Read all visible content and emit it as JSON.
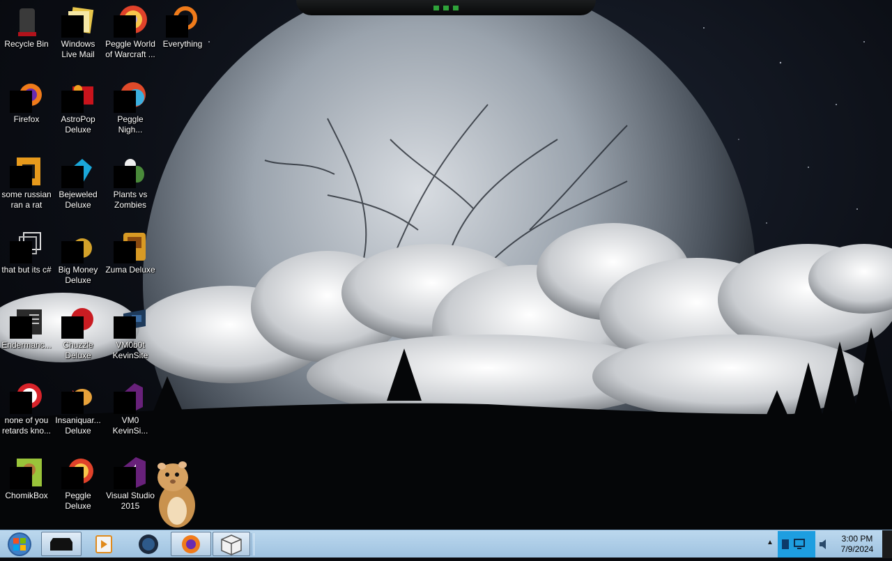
{
  "desktop": {
    "icons": [
      {
        "label": "Recycle Bin",
        "icon": "recycle-bin-icon"
      },
      {
        "label": "Windows Live Mail",
        "icon": "mail-icon"
      },
      {
        "label": "Peggle World of Warcraft ...",
        "icon": "peggle-icon"
      },
      {
        "label": "Everything",
        "icon": "search-app-icon"
      },
      {
        "label": "Firefox",
        "icon": "firefox-icon"
      },
      {
        "label": "AstroPop Deluxe",
        "icon": "game-icon"
      },
      {
        "label": "Peggle Nigh...",
        "icon": "peggle-icon"
      },
      {
        "label": "some russian ran a rat",
        "icon": "file-icon"
      },
      {
        "label": "Bejeweled Deluxe",
        "icon": "gem-icon"
      },
      {
        "label": "Plants vs Zombies",
        "icon": "plant-icon"
      },
      {
        "label": "that but its c#",
        "icon": "copy-icon"
      },
      {
        "label": "Big Money Deluxe",
        "icon": "money-icon"
      },
      {
        "label": "Zuma Deluxe",
        "icon": "game-icon"
      },
      {
        "label": "Endermanc...",
        "icon": "document-icon"
      },
      {
        "label": "Chuzzle Deluxe",
        "icon": "game-icon"
      },
      {
        "label": "VM0b0t KevinSite",
        "icon": "vm-icon"
      },
      {
        "label": "none of you retards kno...",
        "icon": "app-icon"
      },
      {
        "label": "Insaniquar... Deluxe",
        "icon": "fish-icon"
      },
      {
        "label": "VM0 KevinSi...",
        "icon": "visual-studio-icon"
      },
      {
        "label": "ChomikBox",
        "icon": "chomikbox-icon"
      },
      {
        "label": "Peggle Deluxe",
        "icon": "peggle-icon"
      },
      {
        "label": "Visual Studio 2015",
        "icon": "visual-studio-icon"
      }
    ]
  },
  "taskbar": {
    "apps": [
      "terminal-icon",
      "media-player-icon",
      "browser-globe-icon",
      "firefox-icon",
      "package-icon"
    ]
  },
  "clock": {
    "time": "3:00 PM",
    "date": "7/9/2024"
  },
  "colors": {
    "taskbar": "#a9cbe6",
    "tray_highlight": "#1e9ee0"
  }
}
